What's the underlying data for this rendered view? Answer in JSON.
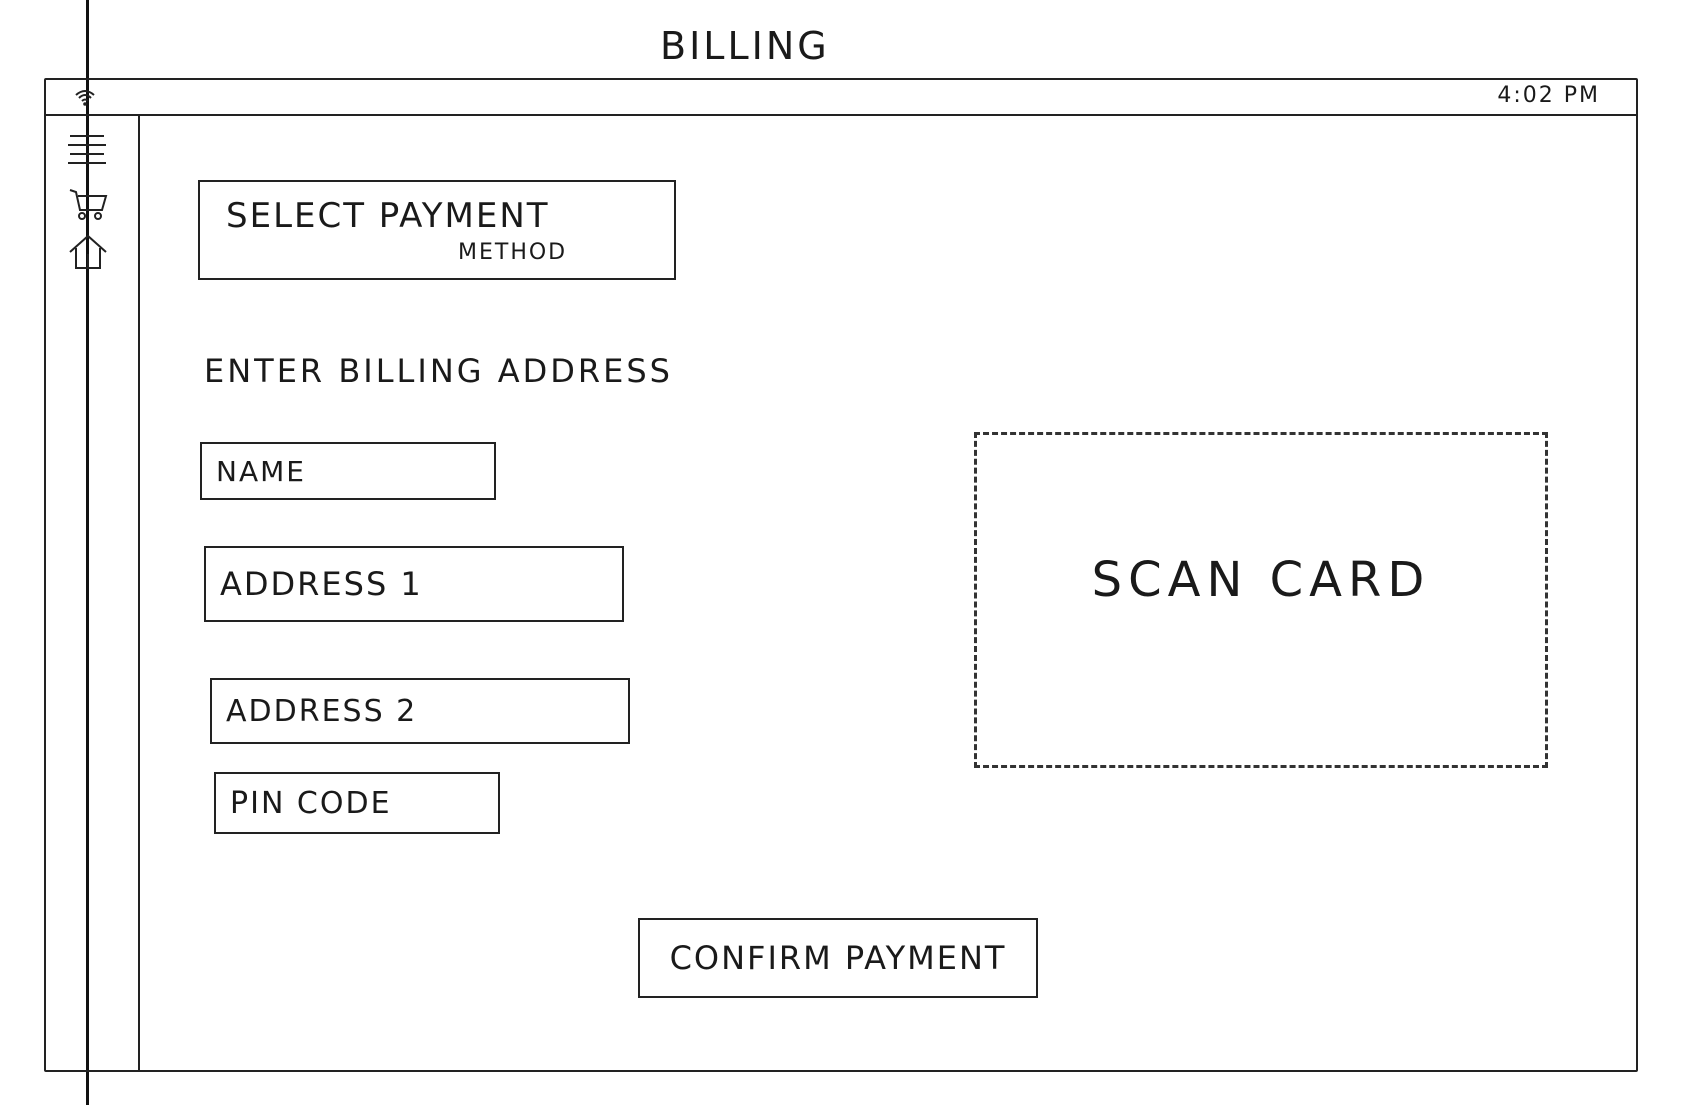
{
  "page": {
    "title": "BILLING"
  },
  "status_bar": {
    "time": "4:02 PM",
    "icons": [
      "wifi-icon"
    ]
  },
  "sidebar": {
    "items": [
      {
        "icon": "menu-icon"
      },
      {
        "icon": "cart-icon"
      },
      {
        "icon": "home-icon"
      }
    ]
  },
  "payment": {
    "select_label_line1": "SELECT PAYMENT",
    "select_label_line2": "METHOD"
  },
  "billing": {
    "heading": "ENTER BILLING ADDRESS",
    "name_placeholder": "NAME",
    "address1_placeholder": "ADDRESS 1",
    "address2_placeholder": "ADDRESS 2",
    "pincode_placeholder": "PIN CODE"
  },
  "scan": {
    "label": "SCAN CARD"
  },
  "actions": {
    "confirm_label": "CONFIRM PAYMENT"
  },
  "colors": {
    "ink": "#1a1a1a",
    "paper": "#ffffff"
  }
}
